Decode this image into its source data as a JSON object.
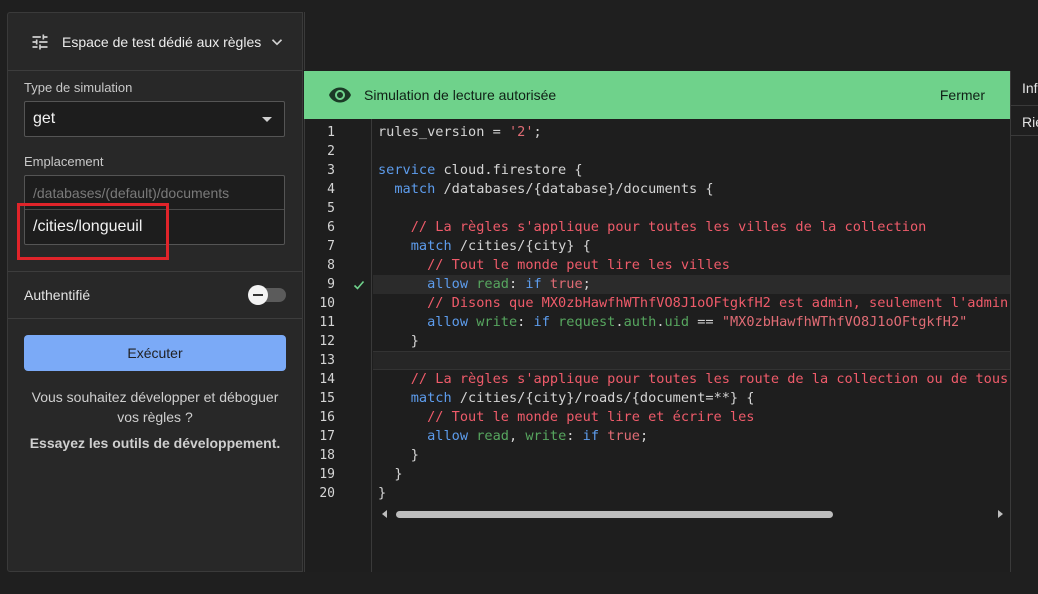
{
  "sidebar": {
    "header_title": "Espace de test dédié aux règles",
    "simulation_type_label": "Type de simulation",
    "simulation_type_value": "get",
    "location_label": "Emplacement",
    "location_prefix": "/databases/(default)/documents",
    "location_value": "/cities/longueuil",
    "auth_label": "Authentifié",
    "auth_enabled": false,
    "run_label": "Exécuter",
    "dev_prompt": "Vous souhaitez développer et déboguer vos règles ?",
    "dev_link": "Essayez les outils de développement."
  },
  "banner": {
    "message": "Simulation de lecture autorisée",
    "close_label": "Fermer",
    "color": "#6fd28b"
  },
  "info_panel": {
    "title": "Inf",
    "row1": "Rie"
  },
  "editor": {
    "passed_line": 9,
    "lines": [
      [
        [
          "pu",
          "rules_version = "
        ],
        [
          "str",
          "'2'"
        ],
        [
          "pu",
          ";"
        ]
      ],
      [],
      [
        [
          "kw",
          "service"
        ],
        [
          "pu",
          " cloud.firestore {"
        ]
      ],
      [
        [
          "pu",
          "  "
        ],
        [
          "kw",
          "match"
        ],
        [
          "pu",
          " /databases/{database}/documents {"
        ]
      ],
      [],
      [
        [
          "pu",
          "    "
        ],
        [
          "cm",
          "// La règles s'applique pour toutes les villes de la collection"
        ]
      ],
      [
        [
          "pu",
          "    "
        ],
        [
          "kw",
          "match"
        ],
        [
          "pu",
          " /cities/{city} {"
        ]
      ],
      [
        [
          "pu",
          "      "
        ],
        [
          "cm",
          "// Tout le monde peut lire les villes"
        ]
      ],
      [
        [
          "pu",
          "      "
        ],
        [
          "kw",
          "allow"
        ],
        [
          "pu",
          " "
        ],
        [
          "id",
          "read"
        ],
        [
          "pu",
          ": "
        ],
        [
          "kw",
          "if"
        ],
        [
          "pu",
          " "
        ],
        [
          "str",
          "true"
        ],
        [
          "pu",
          ";"
        ]
      ],
      [
        [
          "pu",
          "      "
        ],
        [
          "cm",
          "// Disons que MX0zbHawfhWThfVO8J1oOFtgkfH2 est admin, seulement l'admin"
        ]
      ],
      [
        [
          "pu",
          "      "
        ],
        [
          "kw",
          "allow"
        ],
        [
          "pu",
          " "
        ],
        [
          "id",
          "write"
        ],
        [
          "pu",
          ": "
        ],
        [
          "kw",
          "if"
        ],
        [
          "pu",
          " "
        ],
        [
          "id",
          "request"
        ],
        [
          "pu",
          "."
        ],
        [
          "id",
          "auth"
        ],
        [
          "pu",
          "."
        ],
        [
          "id",
          "uid"
        ],
        [
          "pu",
          " == "
        ],
        [
          "str",
          "\"MX0zbHawfhWThfVO8J1oOFtgkfH2\""
        ]
      ],
      [
        [
          "pu",
          "    }"
        ]
      ],
      [],
      [
        [
          "pu",
          "    "
        ],
        [
          "cm",
          "// La règles s'applique pour toutes les route de la collection ou de tous"
        ]
      ],
      [
        [
          "pu",
          "    "
        ],
        [
          "kw",
          "match"
        ],
        [
          "pu",
          " /cities/{city}/roads/{document=**} {"
        ]
      ],
      [
        [
          "pu",
          "      "
        ],
        [
          "cm",
          "// Tout le monde peut lire et écrire les"
        ]
      ],
      [
        [
          "pu",
          "      "
        ],
        [
          "kw",
          "allow"
        ],
        [
          "pu",
          " "
        ],
        [
          "id",
          "read"
        ],
        [
          "pu",
          ", "
        ],
        [
          "id",
          "write"
        ],
        [
          "pu",
          ": "
        ],
        [
          "kw",
          "if"
        ],
        [
          "pu",
          " "
        ],
        [
          "str",
          "true"
        ],
        [
          "pu",
          ";"
        ]
      ],
      [
        [
          "pu",
          "    }"
        ]
      ],
      [
        [
          "pu",
          "  }"
        ]
      ],
      [
        [
          "pu",
          "}"
        ]
      ]
    ]
  }
}
